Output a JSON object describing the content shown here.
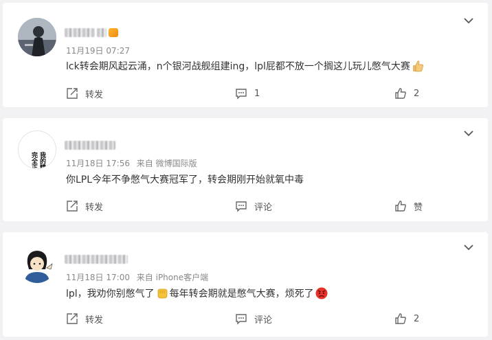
{
  "comments": [
    {
      "date": "11月19日",
      "time": "07:27",
      "source": "",
      "text_parts": [
        "lck转会期风起云涌，n个银河战舰组建ing，lpl屁都不放一个搁这儿玩儿憋气大赛"
      ],
      "repost_label": "转发",
      "comment_label": "1",
      "like_label": "2"
    },
    {
      "date": "11月18日",
      "time": "17:56",
      "source": "来自 微博国际版",
      "text_parts": [
        "你LPL今年不争憋气大赛冠军了，转会期刚开始就氧中毒"
      ],
      "repost_label": "转发",
      "comment_label": "评论",
      "like_label": "赞",
      "avatar_text": [
        "我的精神",
        "完全正常"
      ]
    },
    {
      "date": "11月18日",
      "time": "17:00",
      "source": "来自 iPhone客户端",
      "text_parts": [
        "lpl，我劝你别憋气了",
        "每年转会期就是憋气大赛，烦死了"
      ],
      "repost_label": "转发",
      "comment_label": "评论",
      "like_label": "2"
    }
  ],
  "icons": {
    "more": "chevron-down-icon",
    "repost": "repost-icon",
    "comment": "comment-icon",
    "like": "thumbs-up-icon",
    "emoji1": "thumbs-up-emoji",
    "emoji2": "fist-emoji",
    "emoji3": "angry-face-emoji"
  },
  "colors": {
    "background": "#f2f2f5",
    "card": "#ffffff",
    "text": "#333333",
    "meta": "#888888",
    "vip": "#f08a12"
  }
}
